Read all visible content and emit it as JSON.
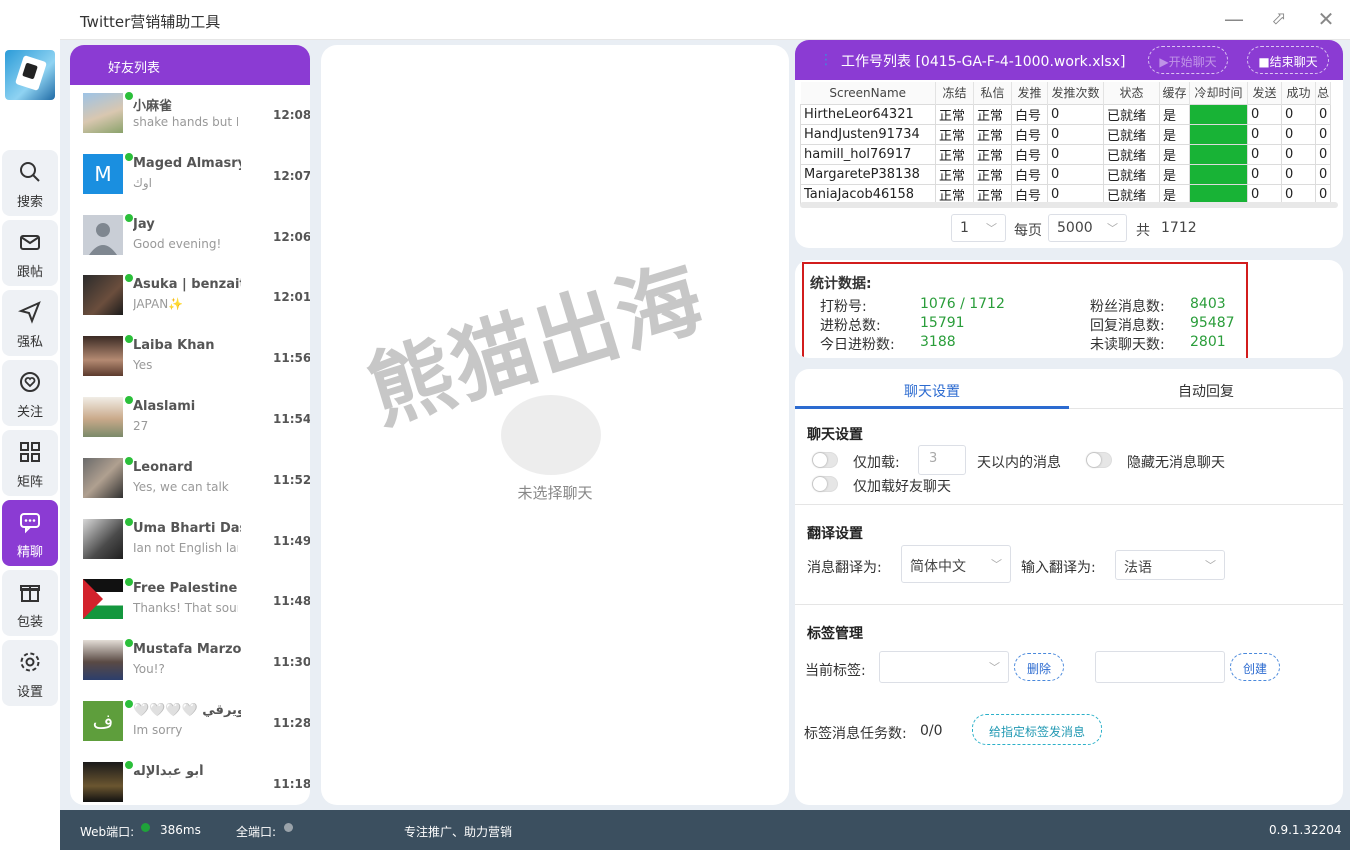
{
  "app": {
    "title": "Twitter营销辅助工具"
  },
  "window": {
    "minimize": "—",
    "maximize": "⬀",
    "close": "✕"
  },
  "colors": {
    "accent": "#8b3bd3",
    "online": "#2bbf3a",
    "ok_green": "#18b336",
    "stat_value": "#2a9d3a",
    "highlight_border": "#d21c1c",
    "statusbar": "#3b4f5f"
  },
  "nav": [
    {
      "label": "搜索",
      "icon": "search-icon"
    },
    {
      "label": "跟帖",
      "icon": "mail-icon"
    },
    {
      "label": "强私",
      "icon": "send-icon"
    },
    {
      "label": "关注",
      "icon": "heart-icon"
    },
    {
      "label": "矩阵",
      "icon": "grid-icon"
    },
    {
      "label": "精聊",
      "icon": "chat-icon",
      "active": true
    },
    {
      "label": "包装",
      "icon": "gift-icon"
    },
    {
      "label": "设置",
      "icon": "gear-icon"
    }
  ],
  "friends": {
    "title": "好友列表",
    "items": [
      {
        "name": "小麻雀",
        "msg": "shake hands but I r",
        "time": "12:08",
        "avatar": "photo-blossom"
      },
      {
        "name": "Maged Almasry",
        "msg": "اوك",
        "time": "12:07",
        "avatar": "letter-M"
      },
      {
        "name": "Jay",
        "msg": "Good evening!",
        "time": "12:06",
        "avatar": "default-user"
      },
      {
        "name": "Asuka | benzaiter",
        "msg": "JAPAN✨",
        "time": "12:01",
        "avatar": "photo-dark"
      },
      {
        "name": "Laiba Khan",
        "msg": "Yes",
        "time": "11:56",
        "avatar": "photo-woman"
      },
      {
        "name": "Alaslami",
        "msg": "27",
        "time": "11:54",
        "avatar": "photo-cartoon"
      },
      {
        "name": "Leonard",
        "msg": "Yes, we can talk",
        "time": "11:52",
        "avatar": "photo-car"
      },
      {
        "name": "Uma Bharti Dasi",
        "msg": "Ian not English lang",
        "time": "11:49",
        "avatar": "photo-woman2"
      },
      {
        "name": "Free Palestine",
        "msg": "Thanks! That sounc",
        "time": "11:48",
        "avatar": "flag-palestine"
      },
      {
        "name": "Mustafa Marzok",
        "msg": "You!?",
        "time": "11:30",
        "avatar": "photo-man"
      },
      {
        "name": "🤍🤍🤍🤍 طويرقي",
        "msg": "Im sorry",
        "time": "11:28",
        "avatar": "letter-ف"
      },
      {
        "name": "أبو عبدالإله",
        "msg": "",
        "time": "11:18",
        "avatar": "photo-text"
      }
    ]
  },
  "chat": {
    "watermark": "熊猫出海",
    "empty_text": "未选择聊天"
  },
  "worklist": {
    "title": "工作号列表 [0415-GA-F-4-1000.work.xlsx]",
    "start_button": "▶开始聊天",
    "end_button": "■结束聊天",
    "columns": [
      "ScreenName",
      "冻结",
      "私信",
      "发推",
      "发推次数",
      "状态",
      "缓存",
      "冷却时间",
      "发送",
      "成功",
      "总"
    ],
    "rows": [
      [
        "HirtheLeor64321",
        "正常",
        "正常",
        "白号",
        "0",
        "已就绪",
        "是",
        "",
        "0",
        "0",
        "0"
      ],
      [
        "HandJusten91734",
        "正常",
        "正常",
        "白号",
        "0",
        "已就绪",
        "是",
        "",
        "0",
        "0",
        "0"
      ],
      [
        "hamill_hol76917",
        "正常",
        "正常",
        "白号",
        "0",
        "已就绪",
        "是",
        "",
        "0",
        "0",
        "0"
      ],
      [
        "MargareteP38138",
        "正常",
        "正常",
        "白号",
        "0",
        "已就绪",
        "是",
        "",
        "0",
        "0",
        "0"
      ],
      [
        "TaniaJacob46158",
        "正常",
        "正常",
        "白号",
        "0",
        "已就绪",
        "是",
        "",
        "0",
        "0",
        "0"
      ]
    ],
    "pager": {
      "page": "1",
      "per_page_label": "每页",
      "per_page": "5000",
      "total_label": "共",
      "total": "1712"
    }
  },
  "stats": {
    "title": "统计数据:",
    "left": [
      {
        "label": "打粉号:",
        "value": "1076 / 1712"
      },
      {
        "label": "进粉总数:",
        "value": "15791"
      },
      {
        "label": "今日进粉数:",
        "value": "3188"
      }
    ],
    "right": [
      {
        "label": "粉丝消息数:",
        "value": "8403"
      },
      {
        "label": "回复消息数:",
        "value": "95487"
      },
      {
        "label": "未读聊天数:",
        "value": "2801"
      }
    ]
  },
  "settings": {
    "tabs": [
      "聊天设置",
      "自动回复"
    ],
    "chat": {
      "title": "聊天设置",
      "load_only": "仅加载:",
      "days_placeholder": "3",
      "days_suffix": "天以内的消息",
      "hide_no_msg": "隐藏无消息聊天",
      "friends_only": "仅加载好友聊天"
    },
    "translate": {
      "title": "翻译设置",
      "msg_label": "消息翻译为:",
      "msg_value": "简体中文",
      "input_label": "输入翻译为:",
      "input_value": "法语"
    },
    "tags": {
      "title": "标签管理",
      "current_label": "当前标签:",
      "delete": "删除",
      "create": "创建",
      "task_label": "标签消息任务数:",
      "task_value": "0/0",
      "send_button": "给指定标签发消息"
    }
  },
  "statusbar": {
    "web_port": "Web端口:",
    "latency": "386ms",
    "all_port": "全端口:",
    "slogan": "专注推广、助力营销",
    "version": "0.9.1.32204"
  }
}
